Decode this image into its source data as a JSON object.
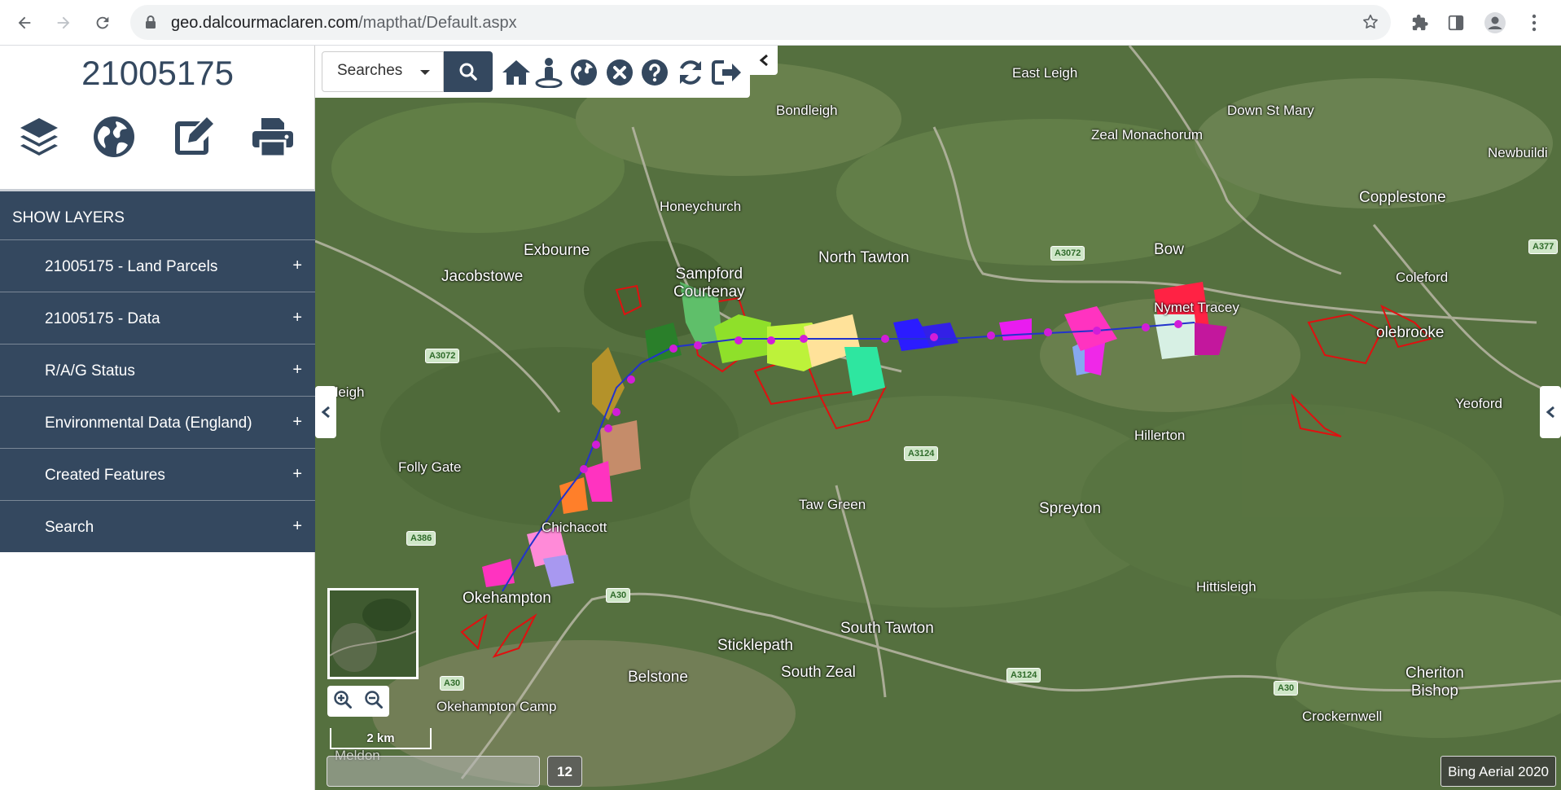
{
  "browser": {
    "url_host": "geo.dalcourmaclaren.com",
    "url_path": "/mapthat/Default.aspx"
  },
  "sidebar": {
    "title": "21005175",
    "tools": [
      "layers-icon",
      "globe-icon",
      "edit-icon",
      "print-icon"
    ],
    "layers_header": "SHOW LAYERS",
    "layers": [
      {
        "label": "21005175 - Land Parcels",
        "toggle": "+"
      },
      {
        "label": "21005175 - Data",
        "toggle": "+"
      },
      {
        "label": "R/A/G Status",
        "toggle": "+"
      },
      {
        "label": "Environmental Data (England)",
        "toggle": "+"
      },
      {
        "label": "Created Features",
        "toggle": "+"
      },
      {
        "label": "Search",
        "toggle": "+"
      }
    ]
  },
  "toolbar": {
    "search_select": "Searches",
    "icons": [
      "home-icon",
      "streetview-icon",
      "globe-icon",
      "clear-icon",
      "help-icon",
      "refresh-icon",
      "logout-icon"
    ]
  },
  "map": {
    "places": [
      "East Leigh",
      "Bondleigh",
      "Down St Mary",
      "Zeal Monachorum",
      "Newbuildi",
      "Copplestone",
      "Honeychurch",
      "Exbourne",
      "Jacobstowe",
      "Sampford\nCourtenay",
      "North Tawton",
      "Bow",
      "Nymet Tracey",
      "Coleford",
      "olebrooke",
      "ardleigh",
      "Yeoford",
      "Hillerton",
      "Folly Gate",
      "Taw Green",
      "Spreyton",
      "Chichacott",
      "Hittisleigh",
      "Okehampton",
      "South Tawton",
      "Sticklepath",
      "South Zeal",
      "Belstone",
      "Cheriton\nBishop",
      "Crockernwell",
      "Okehampton Camp",
      "Meldon"
    ],
    "roads": [
      "A3072",
      "A3072",
      "A377",
      "A3124",
      "A386",
      "A30",
      "A3124",
      "A30",
      "A30"
    ],
    "scale_label": "2 km",
    "zoom_level": "12",
    "attribution": "Bing Aerial 2020",
    "colors": {
      "panel": "#34485f",
      "parcel_outline": "#e01010",
      "route_points": "#d21dd8"
    }
  }
}
